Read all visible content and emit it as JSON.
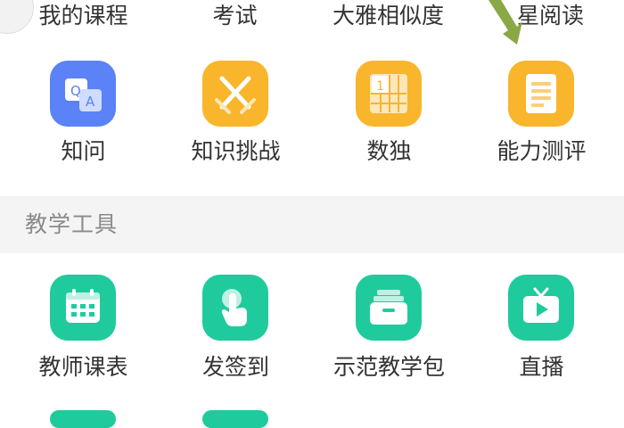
{
  "top_row": {
    "items": [
      {
        "label": "我的课程"
      },
      {
        "label": "考试"
      },
      {
        "label": "大雅相似度"
      },
      {
        "label": "星阅读"
      }
    ]
  },
  "apps_row": {
    "items": [
      {
        "label": "知问",
        "icon": "qa-icon",
        "color": "#5b82f7",
        "icon_text_q": "Q",
        "icon_text_a": "A"
      },
      {
        "label": "知识挑战",
        "icon": "crossed-swords-icon",
        "color": "#f9b52b"
      },
      {
        "label": "数独",
        "icon": "sudoku-grid-icon",
        "color": "#f9b52b",
        "icon_text": "1"
      },
      {
        "label": "能力测评",
        "icon": "document-icon",
        "color": "#f9b52b"
      }
    ]
  },
  "teaching_tools": {
    "title": "教学工具",
    "items": [
      {
        "label": "教师课表",
        "icon": "calendar-icon",
        "color": "#1fcb9c"
      },
      {
        "label": "发签到",
        "icon": "tap-hand-icon",
        "color": "#1fcb9c"
      },
      {
        "label": "示范教学包",
        "icon": "package-box-icon",
        "color": "#1fcb9c"
      },
      {
        "label": "直播",
        "icon": "tv-play-icon",
        "color": "#1fcb9c"
      }
    ]
  },
  "colors": {
    "background": "#ffffff",
    "section_band": "#f4f4f4",
    "text": "#333333",
    "section_title": "#8a8a8a",
    "annotation_arrow": "#8aa845"
  }
}
